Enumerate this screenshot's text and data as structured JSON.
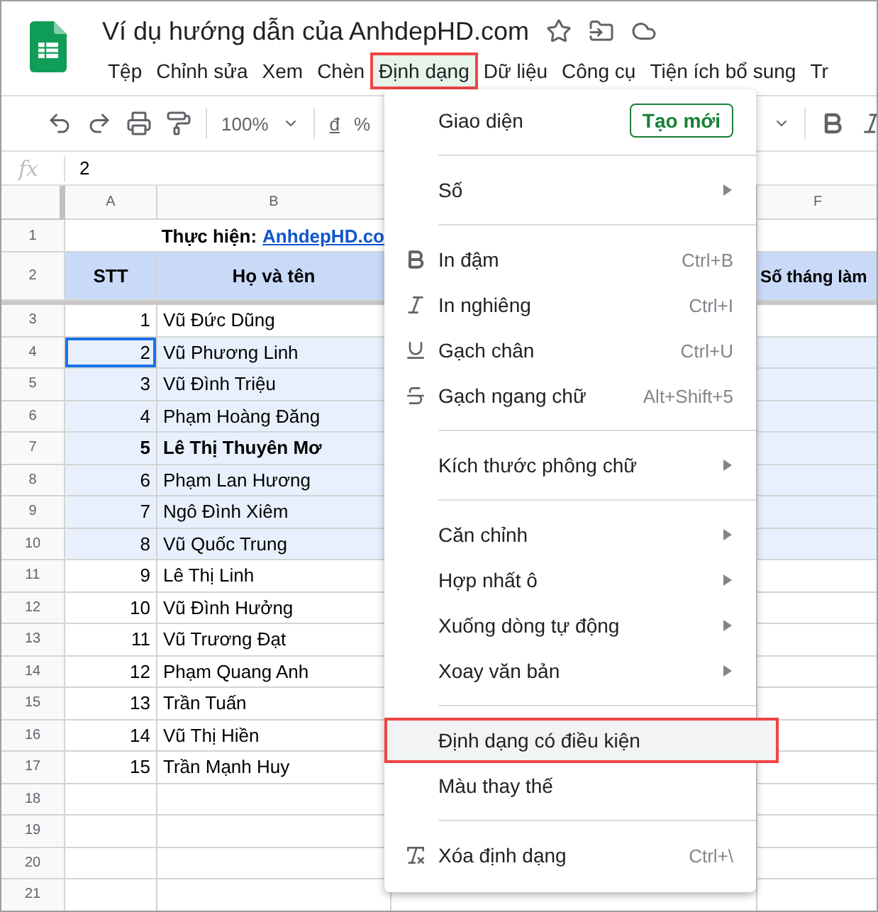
{
  "document": {
    "title": "Ví dụ hướng dẫn của AnhdepHD.com"
  },
  "menubar": [
    {
      "label": "Tệp",
      "selected": false,
      "annotated": false
    },
    {
      "label": "Chỉnh sửa",
      "selected": false,
      "annotated": false
    },
    {
      "label": "Xem",
      "selected": false,
      "annotated": false
    },
    {
      "label": "Chèn",
      "selected": false,
      "annotated": false
    },
    {
      "label": "Định dạng",
      "selected": true,
      "annotated": true
    },
    {
      "label": "Dữ liệu",
      "selected": false,
      "annotated": false
    },
    {
      "label": "Công cụ",
      "selected": false,
      "annotated": false
    },
    {
      "label": "Tiện ích bổ sung",
      "selected": false,
      "annotated": false
    },
    {
      "label": "Tr",
      "selected": false,
      "annotated": false
    }
  ],
  "toolbar": {
    "zoom": "100%",
    "currency": "đ",
    "percent": "%"
  },
  "formula_bar": {
    "fx": "fx",
    "value": "2"
  },
  "sheet": {
    "columns": [
      "A",
      "B",
      "F"
    ],
    "title_row": {
      "number": "1",
      "label": "Thực hiện:",
      "link": "AnhdepHD.co"
    },
    "header_row": {
      "number": "2",
      "stt": "STT",
      "name": "Họ và tên",
      "column_f": "Số tháng làm"
    },
    "rows": [
      {
        "number": "3",
        "stt": "1",
        "name": "Vũ Đức Dũng",
        "selected": false,
        "active": false,
        "bold": false
      },
      {
        "number": "4",
        "stt": "2",
        "name": "Vũ Phương Linh",
        "selected": true,
        "active": true,
        "bold": false
      },
      {
        "number": "5",
        "stt": "3",
        "name": "Vũ Đình Triệu",
        "selected": true,
        "active": false,
        "bold": false
      },
      {
        "number": "6",
        "stt": "4",
        "name": "Phạm Hoàng Đăng",
        "selected": true,
        "active": false,
        "bold": false
      },
      {
        "number": "7",
        "stt": "5",
        "name": "Lê Thị Thuyên Mơ",
        "selected": true,
        "active": false,
        "bold": true
      },
      {
        "number": "8",
        "stt": "6",
        "name": "Phạm Lan Hương",
        "selected": true,
        "active": false,
        "bold": false
      },
      {
        "number": "9",
        "stt": "7",
        "name": "Ngô Đình Xiêm",
        "selected": true,
        "active": false,
        "bold": false
      },
      {
        "number": "10",
        "stt": "8",
        "name": "Vũ Quốc Trung",
        "selected": true,
        "active": false,
        "bold": false
      },
      {
        "number": "11",
        "stt": "9",
        "name": "Lê Thị Linh",
        "selected": false,
        "active": false,
        "bold": false
      },
      {
        "number": "12",
        "stt": "10",
        "name": "Vũ Đình Hưởng",
        "selected": false,
        "active": false,
        "bold": false
      },
      {
        "number": "13",
        "stt": "11",
        "name": "Vũ Trương Đạt",
        "selected": false,
        "active": false,
        "bold": false
      },
      {
        "number": "14",
        "stt": "12",
        "name": "Phạm Quang Anh",
        "selected": false,
        "active": false,
        "bold": false
      },
      {
        "number": "15",
        "stt": "13",
        "name": "Trần Tuấn",
        "selected": false,
        "active": false,
        "bold": false
      },
      {
        "number": "16",
        "stt": "14",
        "name": "Vũ Thị Hiền",
        "selected": false,
        "active": false,
        "bold": false
      },
      {
        "number": "17",
        "stt": "15",
        "name": "Trần Mạnh Huy",
        "selected": false,
        "active": false,
        "bold": false
      }
    ],
    "empty_rows": [
      {
        "number": "18"
      },
      {
        "number": "19"
      },
      {
        "number": "20"
      },
      {
        "number": "21"
      }
    ]
  },
  "format_menu": [
    {
      "kind": "theme",
      "label": "Giao diện",
      "button": "Tạo mới",
      "highlighted": false,
      "annotated": false
    },
    {
      "kind": "divider"
    },
    {
      "kind": "submenu",
      "label": "Số",
      "highlighted": false,
      "annotated": false
    },
    {
      "kind": "divider"
    },
    {
      "kind": "bold",
      "label": "In đậm",
      "shortcut": "Ctrl+B",
      "highlighted": false,
      "annotated": false
    },
    {
      "kind": "italic",
      "label": "In nghiêng",
      "shortcut": "Ctrl+I",
      "highlighted": false,
      "annotated": false
    },
    {
      "kind": "underline",
      "label": "Gạch chân",
      "shortcut": "Ctrl+U",
      "highlighted": false,
      "annotated": false
    },
    {
      "kind": "strikethrough",
      "label": "Gạch ngang chữ",
      "shortcut": "Alt+Shift+5",
      "highlighted": false,
      "annotated": false
    },
    {
      "kind": "divider"
    },
    {
      "kind": "submenu",
      "label": "Kích thước phông chữ",
      "highlighted": false,
      "annotated": false
    },
    {
      "kind": "divider"
    },
    {
      "kind": "submenu",
      "label": "Căn chỉnh",
      "highlighted": false,
      "annotated": false
    },
    {
      "kind": "submenu",
      "label": "Hợp nhất ô",
      "highlighted": false,
      "annotated": false
    },
    {
      "kind": "submenu",
      "label": "Xuống dòng tự động",
      "highlighted": false,
      "annotated": false
    },
    {
      "kind": "submenu",
      "label": "Xoay văn bản",
      "highlighted": false,
      "annotated": false
    },
    {
      "kind": "divider"
    },
    {
      "kind": "command",
      "label": "Định dạng có điều kiện",
      "highlighted": true,
      "annotated": true
    },
    {
      "kind": "command",
      "label": "Màu thay thế",
      "highlighted": false,
      "annotated": false
    },
    {
      "kind": "divider"
    },
    {
      "kind": "clear",
      "label": "Xóa định dạng",
      "shortcut": "Ctrl+\\",
      "highlighted": false,
      "annotated": false
    }
  ]
}
